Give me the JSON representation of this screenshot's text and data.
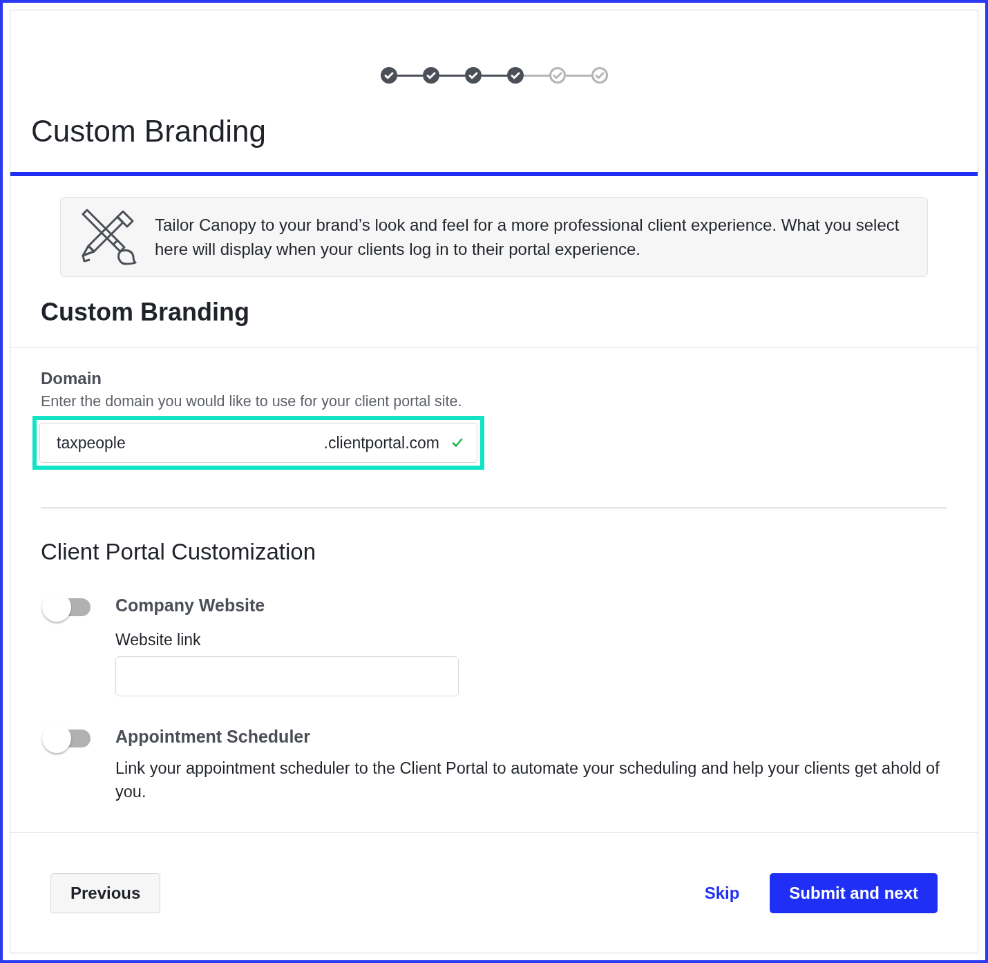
{
  "steps": [
    {
      "completed": true
    },
    {
      "completed": true
    },
    {
      "completed": true
    },
    {
      "completed": true
    },
    {
      "completed": false
    },
    {
      "completed": false
    }
  ],
  "page_title": "Custom Branding",
  "info_banner": {
    "text": "Tailor Canopy to your brand’s look and feel for a more professional client experience. What you select here will display when your clients log in to their portal experience."
  },
  "section_title": "Custom Branding",
  "domain": {
    "label": "Domain",
    "description": "Enter the domain you would like to use for your client portal site.",
    "value": "taxpeople",
    "suffix": ".clientportal.com",
    "valid": true,
    "highlighted": true
  },
  "customization": {
    "title": "Client Portal Customization",
    "options": [
      {
        "kind": "link",
        "title": "Company Website",
        "on": false,
        "field_label": "Website link"
      },
      {
        "kind": "description",
        "title": "Appointment Scheduler",
        "on": false,
        "description": "Link your appointment scheduler to the Client Portal to automate your scheduling and help your clients get ahold of you."
      }
    ]
  },
  "footer": {
    "previous": "Previous",
    "skip": "Skip",
    "submit": "Submit and next"
  }
}
